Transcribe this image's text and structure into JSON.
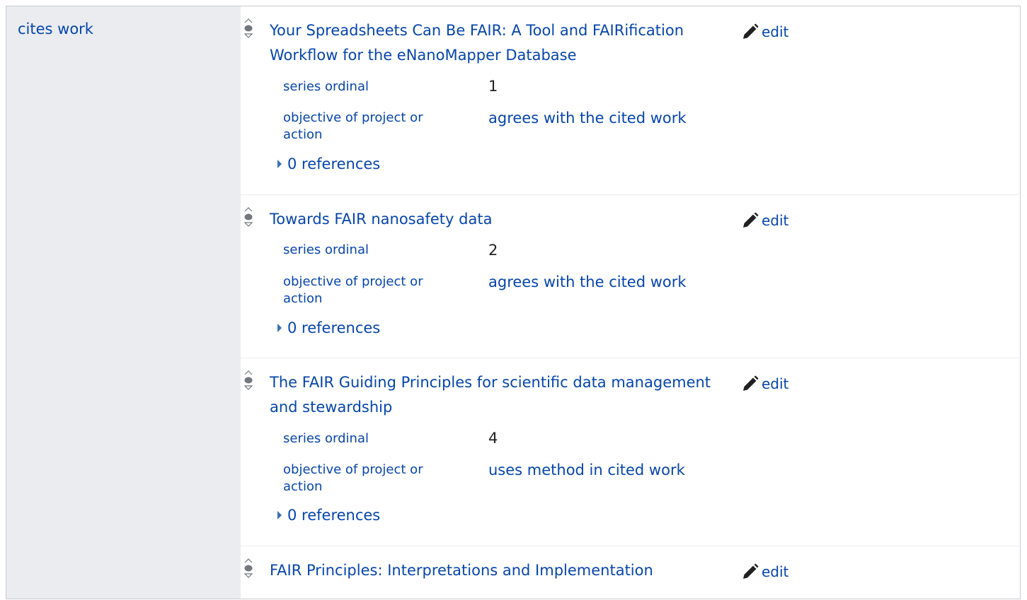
{
  "property": {
    "label": "cites work"
  },
  "edit_label": "edit",
  "statements": [
    {
      "title": "Your Spreadsheets Can Be FAIR: A Tool and FAIRification Workflow for the eNanoMapper Database",
      "qualifiers": [
        {
          "key": "series ordinal",
          "value": "1",
          "type": "number"
        },
        {
          "key": "objective of project or action",
          "value": "agrees with the cited work",
          "type": "link"
        }
      ],
      "references": "0 references"
    },
    {
      "title": "Towards FAIR nanosafety data",
      "qualifiers": [
        {
          "key": "series ordinal",
          "value": "2",
          "type": "number"
        },
        {
          "key": "objective of project or action",
          "value": "agrees with the cited work",
          "type": "link"
        }
      ],
      "references": "0 references"
    },
    {
      "title": "The FAIR Guiding Principles for scientific data management and stewardship",
      "qualifiers": [
        {
          "key": "series ordinal",
          "value": "4",
          "type": "number"
        },
        {
          "key": "objective of project or action",
          "value": "uses method in cited work",
          "type": "link"
        }
      ],
      "references": "0 references"
    },
    {
      "title": "FAIR Principles: Interpretations and Implementation",
      "qualifiers": [],
      "references": ""
    }
  ]
}
